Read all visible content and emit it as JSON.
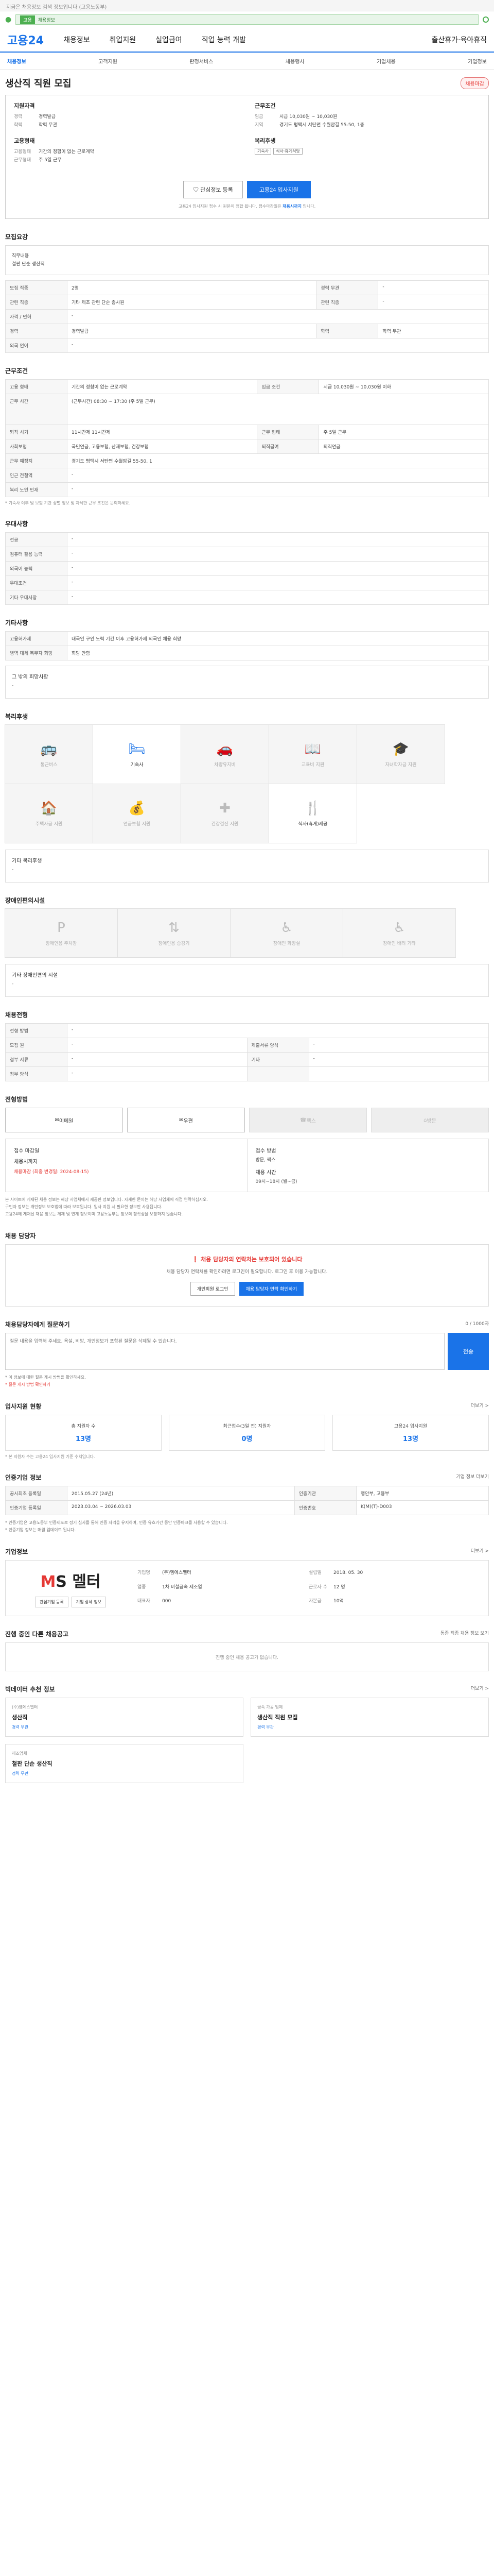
{
  "top_note": "지금은 채용정보 검색 정보입니다 (고용노동부)",
  "search": {
    "badge": "고용",
    "value": "채용정보"
  },
  "gnb": {
    "brand": "고용24",
    "menus": [
      "채용정보",
      "취업지원",
      "실업급여",
      "직업 능력 개발",
      "출산휴가·육아휴직"
    ]
  },
  "lnb": [
    "채용정보",
    "고객지원",
    "판정서비스",
    "채용행사",
    "기업채용",
    "기업정보"
  ],
  "job": {
    "title": "생산직 직원 모집",
    "badge": "채용마감"
  },
  "summary": {
    "qual_h": "지원자격",
    "qual": [
      [
        "경력",
        "경력발급"
      ],
      [
        "학력",
        "학력 무관"
      ]
    ],
    "cond_h": "근무조건",
    "cond": [
      [
        "임금",
        "시급 10,030원 ~ 10,030원"
      ],
      [
        "지역",
        "경기도 평택시 서탄면 수월암길 55-50, 1층"
      ]
    ],
    "type_h": "고용형태",
    "type": [
      [
        "고용형태",
        "기간의 정함이 없는 근로계약"
      ],
      [
        "근무형태",
        "주 5일 근무"
      ]
    ],
    "wel_h": "복리후생",
    "wel": [
      "기숙사",
      "식사·휴게식당"
    ],
    "btn_save": "관심정보 등록",
    "btn_apply": "고용24 입사지원",
    "deadline_pre": "고용24 입사지원 접수 시 원본이 접합 됩니다. 접수마감일은 ",
    "deadline_date": "채용시까지",
    "deadline_post": " 입니다."
  },
  "sec_qual": {
    "title": "모집요강",
    "rows": [
      [
        "직무내용",
        "철판 단순 생산직"
      ]
    ]
  },
  "req": {
    "rows": [
      [
        "모집 직종",
        "2명",
        "경력 무관",
        "-"
      ],
      [
        "관련 직종",
        "기타 제조 관련 단순 종사원",
        "관련 직종",
        "-"
      ],
      [
        "자격 / 면허",
        "-",
        "",
        ""
      ],
      [
        "경력",
        "경력발급",
        "학력",
        "학력 무관"
      ],
      [
        "외국 언어",
        "-",
        "",
        ""
      ]
    ]
  },
  "work": {
    "title": "근무조건",
    "rows": [
      [
        "고용 형태",
        "기간의 정함이 없는 근로계약",
        "임금 조건",
        "시급 10,030원 ~ 10,030원 이하"
      ],
      [
        "근무 시간",
        "(근무시간) 08:30 ~ 17:30 (주 5일 근무)",
        "",
        ""
      ],
      [
        "퇴직 시기",
        "11시간제 11시간제",
        "근무 형태",
        "주 5일 근무"
      ],
      [
        "사회보험",
        "국민연금, 고용보험, 산재보험, 건강보험",
        "퇴직급여",
        "퇴직연금"
      ],
      [
        "근무 예정지",
        "경기도 평택시 서탄면 수월암길 55-50, 1",
        "",
        ""
      ],
      [
        "인근 전철역",
        "-",
        "",
        ""
      ],
      [
        "복리 노인 민재",
        "-",
        "",
        ""
      ]
    ],
    "note": "* 기숙사 여부 및 보험 기관 성별 정보 및 자세한 근무 조건은 문의하세요."
  },
  "pref": {
    "title": "우대사항",
    "rows": [
      [
        "전공",
        "-"
      ],
      [
        "컴퓨터 활용 능력",
        "-"
      ],
      [
        "외국어 능력",
        "-"
      ],
      [
        "우대조건",
        "-"
      ],
      [
        "기타 우대사항",
        "-"
      ]
    ]
  },
  "etc": {
    "title": "기타사항",
    "rows": [
      [
        "고용허가제",
        "내국인 구인 노력 기간 이후 고용허가제 외국인 채용 희망"
      ],
      [
        "병역 대체 복무자 희망",
        "희망 안함"
      ]
    ],
    "note_h": "그 밖의 희망사항",
    "note_v": "-"
  },
  "benefits": {
    "title": "복리후생",
    "items": [
      [
        "통근버스",
        "off"
      ],
      [
        "기숙사",
        "on"
      ],
      [
        "차량유지비",
        "off"
      ],
      [
        "교육비 지원",
        "off"
      ],
      [
        "자녀학자금 지원",
        "off"
      ],
      [
        "주택자금 지원",
        "off"
      ],
      [
        "연금보험 지원",
        "off"
      ],
      [
        "건강검진 지원",
        "off"
      ],
      [
        "식사(휴게)제공",
        "on"
      ]
    ],
    "etc_h": "기타 복리후생",
    "etc_v": "-"
  },
  "disability": {
    "title": "장애인편의시설",
    "items": [
      "장애인용 주차장",
      "장애인용 승강기",
      "장애인 화장실",
      "장애인 배려 기타"
    ],
    "etc_h": "기타 장애인편의 시설",
    "etc_v": "-"
  },
  "recruit": {
    "title": "채용전형",
    "rows": [
      [
        "전형 방법",
        "-"
      ],
      [
        "모집 원",
        "-",
        "제출서류 양식",
        "-"
      ],
      [
        "첨부 서류",
        "-",
        "기타",
        "-"
      ],
      [
        "첨부 양식",
        "-",
        "",
        ""
      ]
    ]
  },
  "apply": {
    "title": "전형방법",
    "buttons": [
      "이메일",
      "우편",
      "팩스",
      "방문"
    ],
    "disabled": [
      2,
      3
    ]
  },
  "period": {
    "deadline_h": "접수 마감일",
    "deadline_v": "채용시까지",
    "close": "채용마감 (최종 변경일: 2024-08-15)",
    "way_h": "접수 방법",
    "way_v": "방문, 팩스",
    "time_h": "채용 시간",
    "time_v": "09시~18시 (월~금)"
  },
  "bullets": [
    "본 사이트에 게재된 채용 정보는 해당 사업체에서 제공한 정보입니다. 자세한 문의는 해당 사업체에 직접 연락하십시오.",
    "구인자 정보는 개인정보 보호법에 따라 보호됩니다. 입사 지원 시 필요한 정보만 사용됩니다.",
    "고용24에 게재된 채용 정보는 게재 및 연계 정보이며 고용노동부는 정보의 정확성을 보장하지 않습니다."
  ],
  "contact": {
    "title": "채용 담당자",
    "warn": "채용 담당자의 연락처는 보호되어 있습니다",
    "text": "채용 담당자 연락처를 확인하려면 로그인이 필요합니다. 로그인 후 이용 가능합니다.",
    "btns": [
      "개인회원 로그인",
      "채용 담당자 연락 확인하기"
    ]
  },
  "ask": {
    "title": "채용담당자에게 질문하기",
    "count": "0 / 1000자",
    "placeholder": "질문 내용을 입력해 주세요. 욕설, 비방, 개인정보가 포함된 질문은 삭제될 수 있습니다.",
    "send": "전송",
    "notes": [
      "* 이 정보에 대한 질문 게시 방법을 확인하세요.",
      "* 질문 게시 방법 확인하기"
    ]
  },
  "stats": {
    "title": "입사지원 현황",
    "more": "더보기 >",
    "items": [
      [
        "총 지원자 수",
        "13명"
      ],
      [
        "최근접수(3일 전) 지원자",
        "0명"
      ],
      [
        "고용24 입사지원",
        "13명"
      ]
    ],
    "note": "* 본 지원자 수는 고용24 입사지원 기준 수치입니다."
  },
  "corp_info": {
    "title": "인증기업 정보",
    "more": "기업 정보 더보기",
    "rows": [
      [
        "공시최초 등록일",
        "2015.05.27 (24년)",
        "인증기관",
        "행안부, 고용부"
      ],
      [
        "인증기업 등록일",
        "2023.03.04 ~ 2026.03.03",
        "인증번호",
        "K(M)(T)-D003"
      ]
    ],
    "notes": [
      "* 인증기업은 고용노동부 인증제도로 정기 심사를 통해 인증 자격을 유지하며, 인증 유효기간 동안 인증마크를 사용할 수 있습니다.",
      "* 인증기업 정보는 매월 업데이트 됩니다."
    ]
  },
  "company": {
    "title": "기업정보",
    "more": "더보기 >",
    "name_a": "M",
    "name_b": "S 멜터",
    "btns": [
      "관심기업 등록",
      "기업 상세 정보"
    ],
    "info": [
      [
        "기업명",
        "(주)엠에스멜터"
      ],
      [
        "설립일",
        "2018. 05. 30"
      ],
      [
        "업종",
        "1차 비철금속 제조업"
      ],
      [
        "근로자 수",
        "12 명"
      ],
      [
        "대표자",
        "000"
      ],
      [
        "자본금",
        "10억"
      ]
    ]
  },
  "other_jobs": {
    "title": "진행 중인 다른 채용공고",
    "more": "동종 직종 채용 정보 보기",
    "empty": "진행 중인 채용 공고가 없습니다."
  },
  "reco": {
    "title": "빅데이터 추천 정보",
    "more": "더보기 >",
    "cards": [
      [
        "(주)엠에스멜터",
        "생산직",
        "경력 무관"
      ],
      [
        "금속 가공 업체",
        "생산직 직원 모집",
        "경력 무관"
      ],
      [
        "제조업체",
        "철판 단순 생산직",
        "경력 무관"
      ]
    ]
  }
}
